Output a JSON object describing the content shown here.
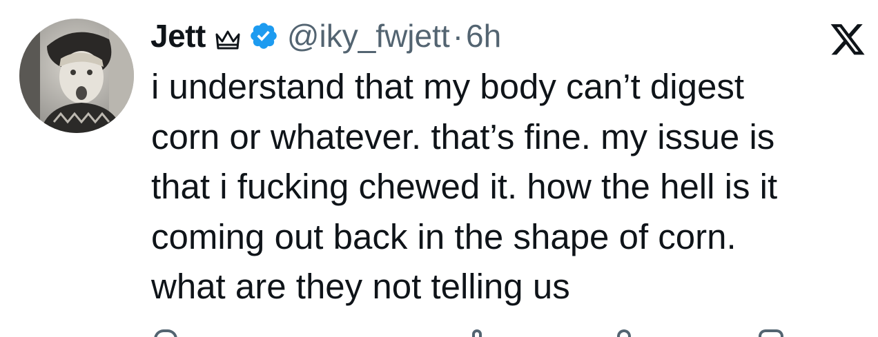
{
  "user": {
    "display_name": "Jett",
    "handle": "@iky_fwjett",
    "separator": "·",
    "time": "6h"
  },
  "icons": {
    "crown": "crown-icon",
    "verified": "verified-badge-icon",
    "platform": "x-logo-icon"
  },
  "colors": {
    "verified": "#1d9bf0",
    "text": "#0f1419",
    "secondary": "#536471"
  },
  "tweet": {
    "lines": [
      "i understand that my body can’t digest",
      "corn or whatever. that’s fine. my issue is",
      "that i fucking chewed it. how the hell is it",
      "coming out back in the shape of corn.",
      "what are they not telling us"
    ]
  }
}
